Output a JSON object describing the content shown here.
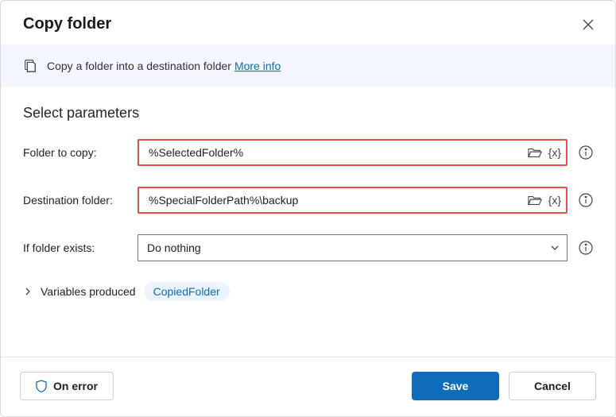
{
  "header": {
    "title": "Copy folder"
  },
  "banner": {
    "text": "Copy a folder into a destination folder",
    "link": "More info"
  },
  "section": {
    "title": "Select parameters"
  },
  "fields": {
    "folder_to_copy": {
      "label": "Folder to copy:",
      "value": "%SelectedFolder%"
    },
    "destination": {
      "label": "Destination folder:",
      "value": "%SpecialFolderPath%\\backup"
    },
    "if_exists": {
      "label": "If folder exists:",
      "value": "Do nothing"
    }
  },
  "variables": {
    "label": "Variables produced",
    "chip": "CopiedFolder"
  },
  "footer": {
    "on_error": "On error",
    "save": "Save",
    "cancel": "Cancel"
  }
}
